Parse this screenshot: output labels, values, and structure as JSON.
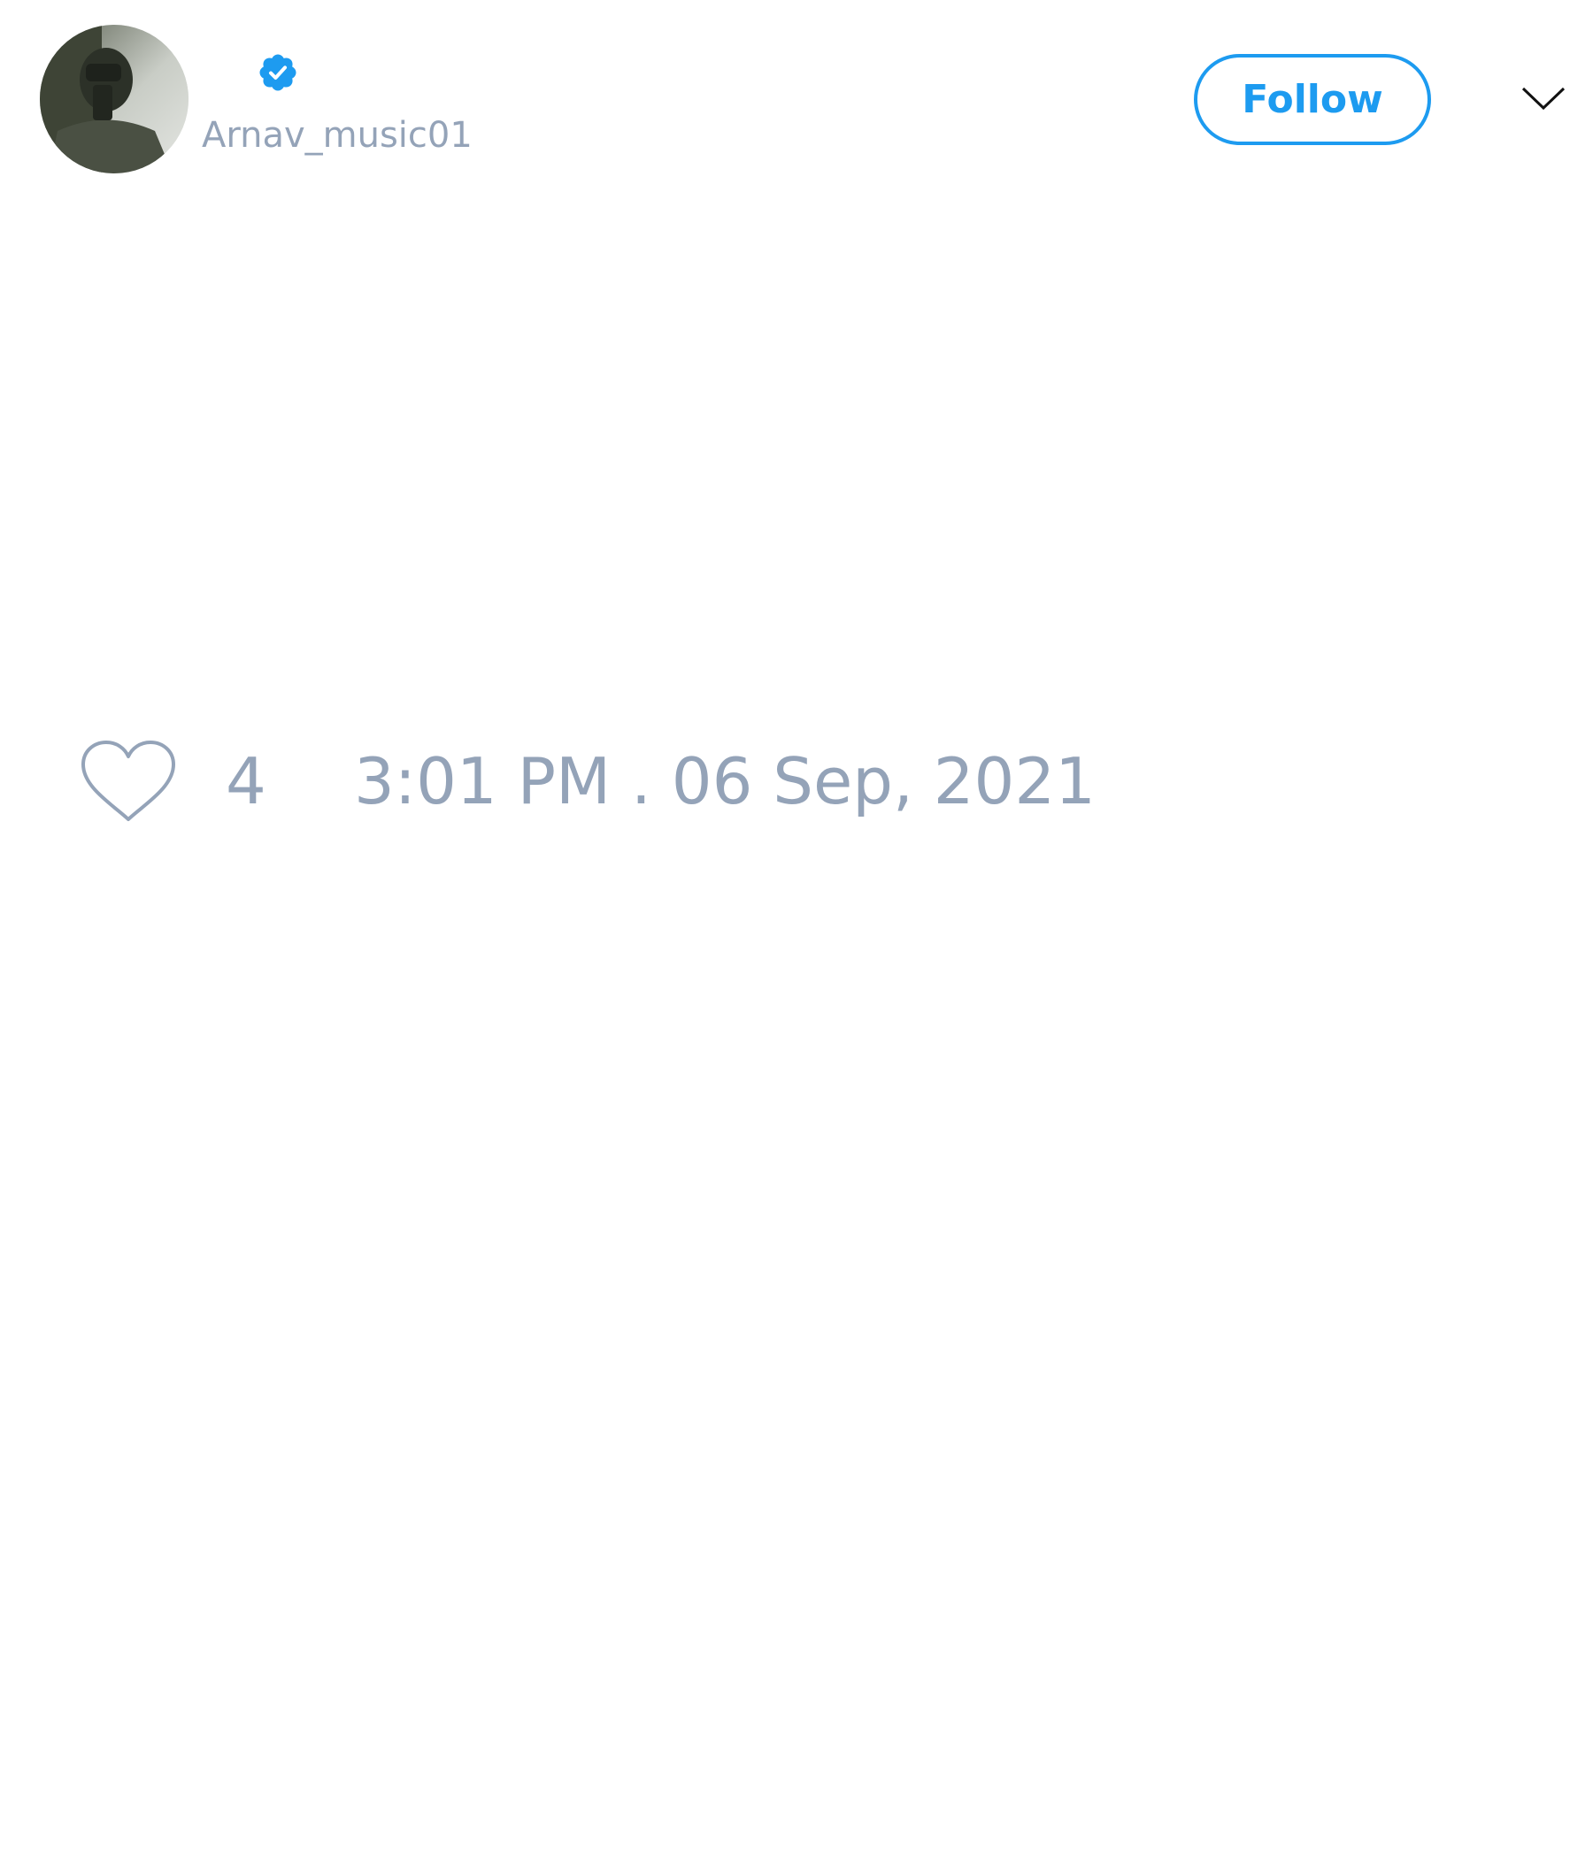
{
  "tweet": {
    "author": {
      "handle": "Arnav_music01",
      "verified": true,
      "avatar_icon": "user-photo-avatar"
    },
    "follow_label": "Follow",
    "menu_icon": "chevron-down-icon",
    "likes": {
      "icon": "heart-outline-icon",
      "count": "4"
    },
    "timestamp": "3:01 PM . 06 Sep, 2021"
  },
  "colors": {
    "accent": "#1d9bf0",
    "muted_text": "#94a3b8",
    "background": "#ffffff"
  }
}
